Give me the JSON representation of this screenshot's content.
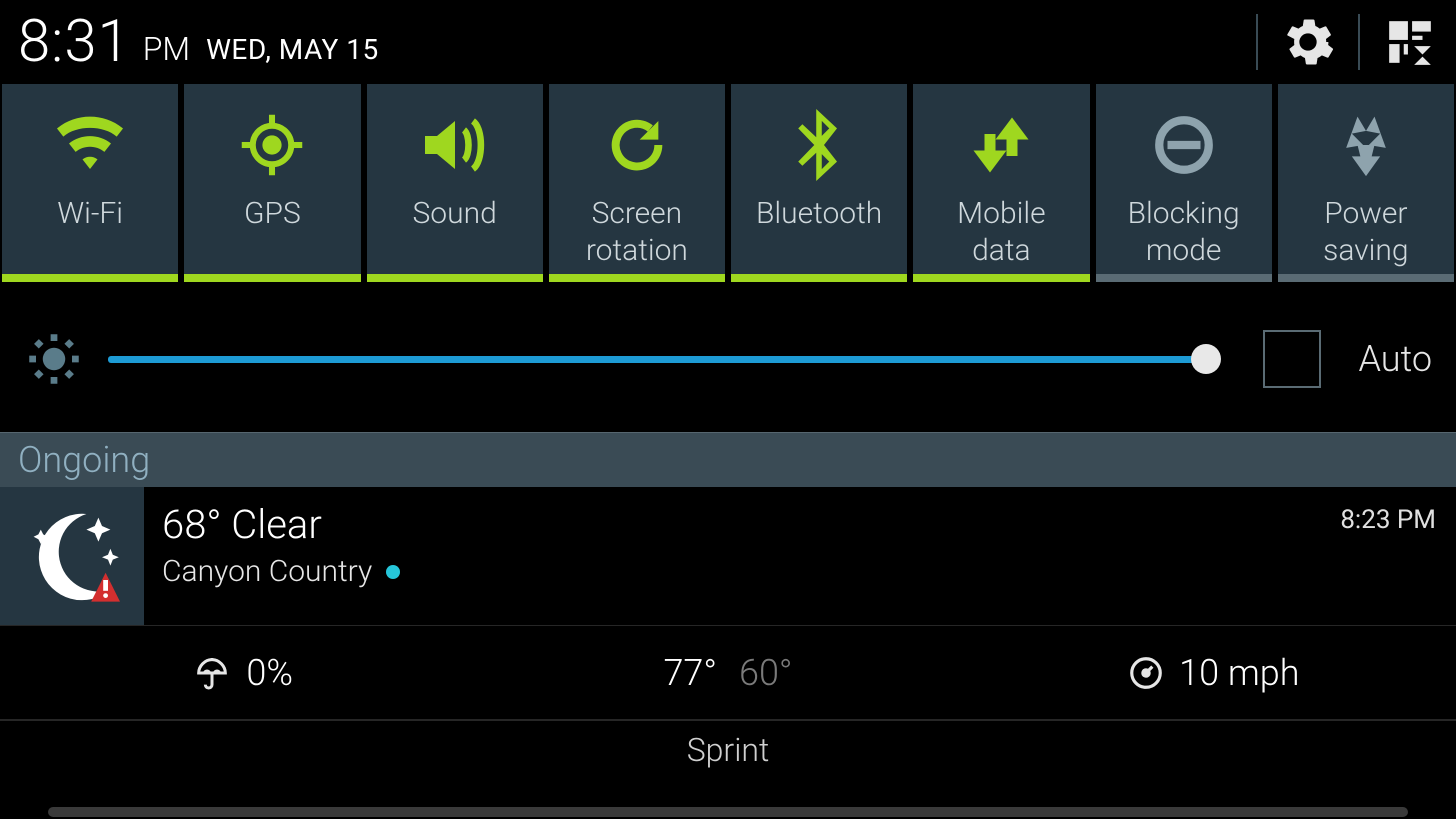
{
  "status": {
    "time": "8:31",
    "ampm": "PM",
    "date": "WED, MAY 15"
  },
  "toggles": [
    {
      "label": "Wi-Fi",
      "on": true,
      "icon": "wifi"
    },
    {
      "label": "GPS",
      "on": true,
      "icon": "gps"
    },
    {
      "label": "Sound",
      "on": true,
      "icon": "sound"
    },
    {
      "label": "Screen\nrotation",
      "on": true,
      "icon": "rotate"
    },
    {
      "label": "Bluetooth",
      "on": true,
      "icon": "bluetooth"
    },
    {
      "label": "Mobile\ndata",
      "on": true,
      "icon": "mobiledata"
    },
    {
      "label": "Blocking\nmode",
      "on": false,
      "icon": "blocking"
    },
    {
      "label": "Power\nsaving",
      "on": false,
      "icon": "powersave"
    }
  ],
  "brightness": {
    "auto_label": "Auto",
    "percent": 99
  },
  "section_ongoing": "Ongoing",
  "weather": {
    "headline": "68° Clear",
    "location": "Canyon Country",
    "time": "8:23 PM",
    "precip": "0%",
    "high": "77°",
    "low": "60°",
    "wind": "10 mph"
  },
  "carrier": "Sprint",
  "colors": {
    "on": "#9fd71f",
    "off": "#8ea3ad",
    "tile": "#253641"
  }
}
